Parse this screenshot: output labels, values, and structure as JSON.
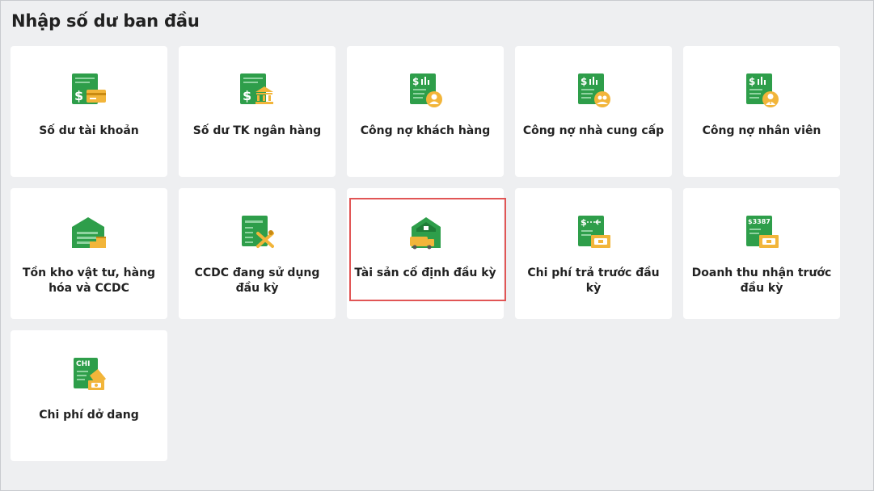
{
  "page": {
    "title": "Nhập số dư ban đầu"
  },
  "cards": [
    {
      "label": "Số dư tài khoản",
      "icon": "money-card-icon"
    },
    {
      "label": "Số dư TK ngân hàng",
      "icon": "bank-balance-icon"
    },
    {
      "label": "Công nợ khách hàng",
      "icon": "customer-debt-icon"
    },
    {
      "label": "Công nợ nhà cung cấp",
      "icon": "supplier-debt-icon"
    },
    {
      "label": "Công nợ nhân viên",
      "icon": "employee-debt-icon"
    },
    {
      "label": "Tồn kho vật tư, hàng hóa và CCDC",
      "icon": "warehouse-icon"
    },
    {
      "label": "CCDC đang sử dụng đầu kỳ",
      "icon": "tools-document-icon"
    },
    {
      "label": "Tài sản cố định đầu kỳ",
      "icon": "fixed-asset-icon",
      "highlighted": true
    },
    {
      "label": "Chi phí trả trước đầu kỳ",
      "icon": "prepaid-expense-icon"
    },
    {
      "label": "Doanh thu nhận trước đầu kỳ",
      "icon": "deferred-revenue-icon",
      "icon_text": "$3387"
    },
    {
      "label": "Chi phí dở dang",
      "icon": "wip-cost-icon",
      "icon_text": "CHI"
    }
  ],
  "colors": {
    "icon_green": "#2e9e4a",
    "icon_dark_green": "#237a39",
    "icon_gold": "#f2b53a",
    "highlight_border": "#e15555"
  }
}
